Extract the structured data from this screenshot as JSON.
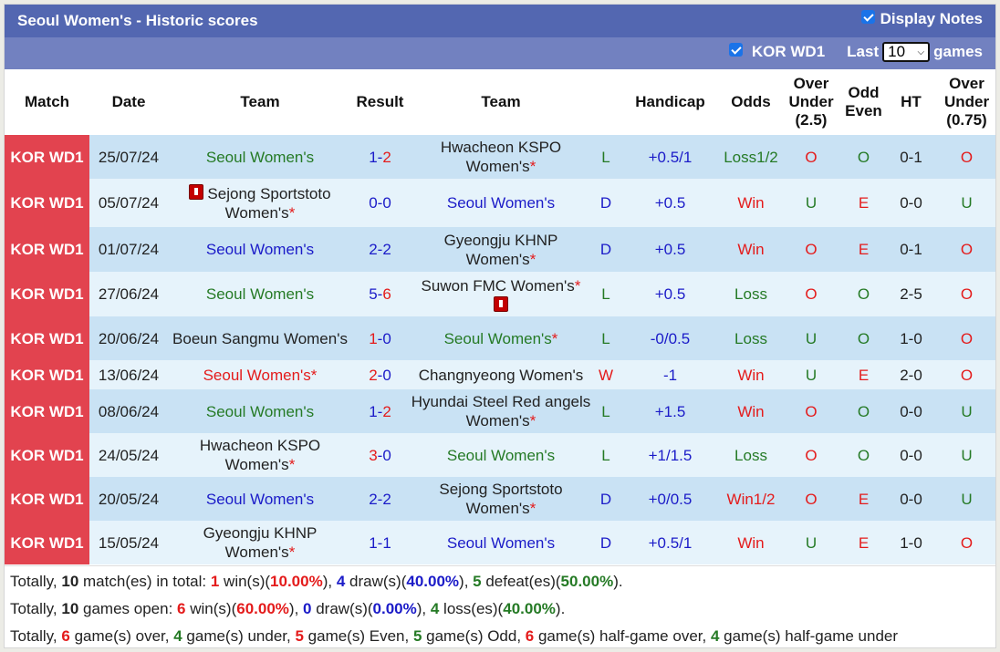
{
  "header": {
    "title": "Seoul Women's - Historic scores",
    "display_notes_label": "Display Notes",
    "display_notes_checked": true
  },
  "filter": {
    "league_label": "KOR WD1",
    "league_checked": true,
    "last_label": "Last",
    "games_count": "10",
    "games_label": "games"
  },
  "columns": {
    "match": "Match",
    "date": "Date",
    "home_team": "Team",
    "result": "Result",
    "away_team": "Team",
    "handicap": "Handicap",
    "odds": "Odds",
    "over_under_1": "Over",
    "over_under_2": "Under",
    "over_under_3": "(2.5)",
    "odd_even_1": "Odd",
    "odd_even_2": "Even",
    "ht": "HT",
    "ou075_1": "Over",
    "ou075_2": "Under",
    "ou075_3": "(0.75)"
  },
  "colors": {
    "league_badge": "#e2434f",
    "title_bar": "#5367b1",
    "filter_bar": "#7281c0",
    "row_odd": "#c9e2f4",
    "row_even": "#e6f3fb",
    "win_red": "#e41b1b",
    "draw_blue": "#1b1bc8",
    "loss_green": "#257a25"
  },
  "rows": [
    {
      "league": "KOR WD1",
      "date": "25/07/24",
      "home": "Seoul Women's",
      "home_star": "",
      "home_card": false,
      "home_color": "green",
      "score_h": "1",
      "score_a": "2",
      "score_h_color": "blue",
      "score_a_color": "red",
      "away": "Hwacheon KSPO Women's",
      "away_star": "*",
      "away_card": false,
      "away_color": "dark",
      "wl": "L",
      "wl_color": "green",
      "handicap": "+0.5/1",
      "odds": "Loss1/2",
      "odds_color": "green",
      "ou": "O",
      "ou_color": "red",
      "oe": "O",
      "oe_color": "green",
      "ht": "0-1",
      "ou075": "O",
      "ou075_color": "red"
    },
    {
      "league": "KOR WD1",
      "date": "05/07/24",
      "home": "Sejong Sportstoto Women's",
      "home_star": "*",
      "home_card": true,
      "home_color": "dark",
      "score_h": "0",
      "score_a": "0",
      "score_h_color": "blue",
      "score_a_color": "blue",
      "away": "Seoul Women's",
      "away_star": "",
      "away_card": false,
      "away_color": "blue",
      "wl": "D",
      "wl_color": "blue",
      "handicap": "+0.5",
      "odds": "Win",
      "odds_color": "red",
      "ou": "U",
      "ou_color": "green",
      "oe": "E",
      "oe_color": "red",
      "ht": "0-0",
      "ou075": "U",
      "ou075_color": "green"
    },
    {
      "league": "KOR WD1",
      "date": "01/07/24",
      "home": "Seoul Women's",
      "home_star": "",
      "home_card": false,
      "home_color": "blue",
      "score_h": "2",
      "score_a": "2",
      "score_h_color": "blue",
      "score_a_color": "blue",
      "away": "Gyeongju KHNP Women's",
      "away_star": "*",
      "away_card": false,
      "away_color": "dark",
      "wl": "D",
      "wl_color": "blue",
      "handicap": "+0.5",
      "odds": "Win",
      "odds_color": "red",
      "ou": "O",
      "ou_color": "red",
      "oe": "E",
      "oe_color": "red",
      "ht": "0-1",
      "ou075": "O",
      "ou075_color": "red"
    },
    {
      "league": "KOR WD1",
      "date": "27/06/24",
      "home": "Seoul Women's",
      "home_star": "",
      "home_card": false,
      "home_color": "green",
      "score_h": "5",
      "score_a": "6",
      "score_h_color": "blue",
      "score_a_color": "red",
      "away": "Suwon FMC Women's",
      "away_star": "*",
      "away_card": true,
      "away_color": "dark",
      "wl": "L",
      "wl_color": "green",
      "handicap": "+0.5",
      "odds": "Loss",
      "odds_color": "green",
      "ou": "O",
      "ou_color": "red",
      "oe": "O",
      "oe_color": "green",
      "ht": "2-5",
      "ou075": "O",
      "ou075_color": "red"
    },
    {
      "league": "KOR WD1",
      "date": "20/06/24",
      "home": "Boeun Sangmu Women's",
      "home_star": "",
      "home_card": false,
      "home_color": "dark",
      "score_h": "1",
      "score_a": "0",
      "score_h_color": "red",
      "score_a_color": "blue",
      "away": "Seoul Women's",
      "away_star": "*",
      "away_card": false,
      "away_color": "green",
      "wl": "L",
      "wl_color": "green",
      "handicap": "-0/0.5",
      "odds": "Loss",
      "odds_color": "green",
      "ou": "U",
      "ou_color": "green",
      "oe": "O",
      "oe_color": "green",
      "ht": "1-0",
      "ou075": "O",
      "ou075_color": "red"
    },
    {
      "league": "KOR WD1",
      "date": "13/06/24",
      "home": "Seoul Women's*",
      "home_star": "",
      "home_card": false,
      "home_color": "red",
      "score_h": "2",
      "score_a": "0",
      "score_h_color": "red",
      "score_a_color": "blue",
      "away": "Changnyeong Women's",
      "away_star": "",
      "away_card": false,
      "away_color": "dark",
      "wl": "W",
      "wl_color": "red",
      "handicap": "-1",
      "odds": "Win",
      "odds_color": "red",
      "ou": "U",
      "ou_color": "green",
      "oe": "E",
      "oe_color": "red",
      "ht": "2-0",
      "ou075": "O",
      "ou075_color": "red"
    },
    {
      "league": "KOR WD1",
      "date": "08/06/24",
      "home": "Seoul Women's",
      "home_star": "",
      "home_card": false,
      "home_color": "green",
      "score_h": "1",
      "score_a": "2",
      "score_h_color": "blue",
      "score_a_color": "red",
      "away": "Hyundai Steel Red angels Women's",
      "away_star": "*",
      "away_card": false,
      "away_color": "dark",
      "wl": "L",
      "wl_color": "green",
      "handicap": "+1.5",
      "odds": "Win",
      "odds_color": "red",
      "ou": "O",
      "ou_color": "red",
      "oe": "O",
      "oe_color": "green",
      "ht": "0-0",
      "ou075": "U",
      "ou075_color": "green"
    },
    {
      "league": "KOR WD1",
      "date": "24/05/24",
      "home": "Hwacheon KSPO Women's",
      "home_star": "*",
      "home_card": false,
      "home_color": "dark",
      "score_h": "3",
      "score_a": "0",
      "score_h_color": "red",
      "score_a_color": "blue",
      "away": "Seoul Women's",
      "away_star": "",
      "away_card": false,
      "away_color": "green",
      "wl": "L",
      "wl_color": "green",
      "handicap": "+1/1.5",
      "odds": "Loss",
      "odds_color": "green",
      "ou": "O",
      "ou_color": "red",
      "oe": "O",
      "oe_color": "green",
      "ht": "0-0",
      "ou075": "U",
      "ou075_color": "green"
    },
    {
      "league": "KOR WD1",
      "date": "20/05/24",
      "home": "Seoul Women's",
      "home_star": "",
      "home_card": false,
      "home_color": "blue",
      "score_h": "2",
      "score_a": "2",
      "score_h_color": "blue",
      "score_a_color": "blue",
      "away": "Sejong Sportstoto Women's",
      "away_star": "*",
      "away_card": false,
      "away_color": "dark",
      "wl": "D",
      "wl_color": "blue",
      "handicap": "+0/0.5",
      "odds": "Win1/2",
      "odds_color": "red",
      "ou": "O",
      "ou_color": "red",
      "oe": "E",
      "oe_color": "red",
      "ht": "0-0",
      "ou075": "U",
      "ou075_color": "green"
    },
    {
      "league": "KOR WD1",
      "date": "15/05/24",
      "home": "Gyeongju KHNP Women's",
      "home_star": "*",
      "home_card": false,
      "home_color": "dark",
      "score_h": "1",
      "score_a": "1",
      "score_h_color": "blue",
      "score_a_color": "blue",
      "away": "Seoul Women's",
      "away_star": "",
      "away_card": false,
      "away_color": "blue",
      "wl": "D",
      "wl_color": "blue",
      "handicap": "+0.5/1",
      "odds": "Win",
      "odds_color": "red",
      "ou": "U",
      "ou_color": "green",
      "oe": "E",
      "oe_color": "red",
      "ht": "1-0",
      "ou075": "O",
      "ou075_color": "red"
    }
  ],
  "summary": [
    [
      {
        "t": "Totally, ",
        "c": ""
      },
      {
        "t": "10",
        "c": "b"
      },
      {
        "t": " match(es) in total: ",
        "c": ""
      },
      {
        "t": "1",
        "c": "red"
      },
      {
        "t": " win(s)(",
        "c": ""
      },
      {
        "t": "10.00%",
        "c": "red"
      },
      {
        "t": "), ",
        "c": ""
      },
      {
        "t": "4",
        "c": "blue"
      },
      {
        "t": " draw(s)(",
        "c": ""
      },
      {
        "t": "40.00%",
        "c": "blue"
      },
      {
        "t": "), ",
        "c": ""
      },
      {
        "t": "5",
        "c": "green"
      },
      {
        "t": " defeat(es)(",
        "c": ""
      },
      {
        "t": "50.00%",
        "c": "green"
      },
      {
        "t": ").",
        "c": ""
      }
    ],
    [
      {
        "t": "Totally, ",
        "c": ""
      },
      {
        "t": "10",
        "c": "b"
      },
      {
        "t": " games open: ",
        "c": ""
      },
      {
        "t": "6",
        "c": "red"
      },
      {
        "t": " win(s)(",
        "c": ""
      },
      {
        "t": "60.00%",
        "c": "red"
      },
      {
        "t": "), ",
        "c": ""
      },
      {
        "t": "0",
        "c": "blue"
      },
      {
        "t": " draw(s)(",
        "c": ""
      },
      {
        "t": "0.00%",
        "c": "blue"
      },
      {
        "t": "), ",
        "c": ""
      },
      {
        "t": "4",
        "c": "green"
      },
      {
        "t": " loss(es)(",
        "c": ""
      },
      {
        "t": "40.00%",
        "c": "green"
      },
      {
        "t": ").",
        "c": ""
      }
    ],
    [
      {
        "t": "Totally, ",
        "c": ""
      },
      {
        "t": "6",
        "c": "red"
      },
      {
        "t": " game(s) over, ",
        "c": ""
      },
      {
        "t": "4",
        "c": "green"
      },
      {
        "t": " game(s) under, ",
        "c": ""
      },
      {
        "t": "5",
        "c": "red"
      },
      {
        "t": " game(s) Even, ",
        "c": ""
      },
      {
        "t": "5",
        "c": "green"
      },
      {
        "t": " game(s) Odd, ",
        "c": ""
      },
      {
        "t": "6",
        "c": "red"
      },
      {
        "t": " game(s) half-game over, ",
        "c": ""
      },
      {
        "t": "4",
        "c": "green"
      },
      {
        "t": " game(s) half-game under",
        "c": ""
      }
    ]
  ]
}
